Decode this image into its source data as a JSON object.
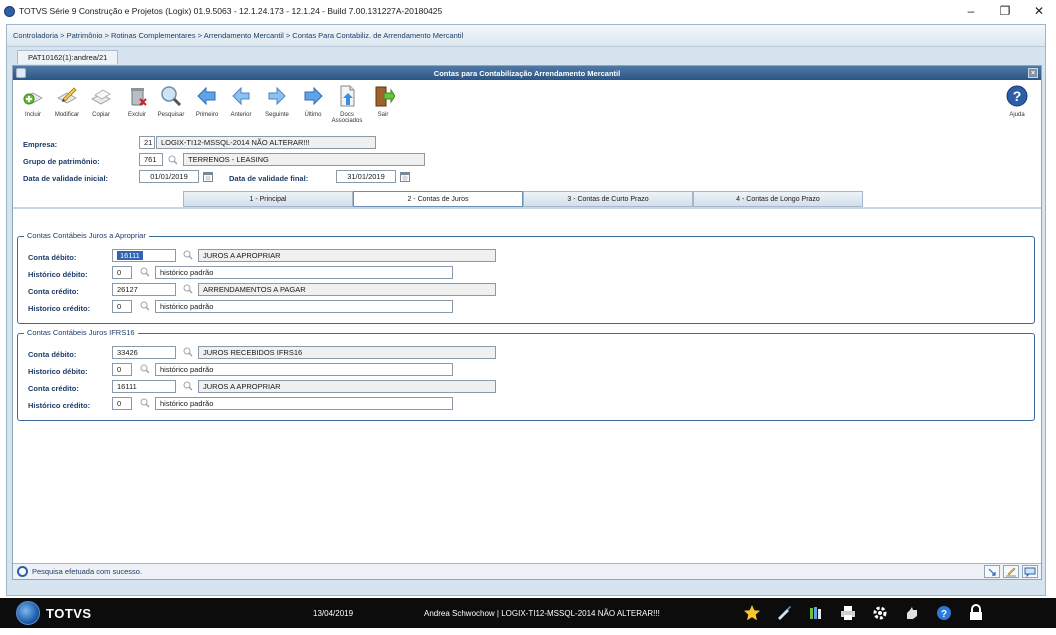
{
  "window": {
    "title": "TOTVS Série 9 Construção e Projetos (Logix) 01.9.5063  -  12.1.24.173  -  12.1.24 - Build 7.00.131227A-20180425",
    "minimize": "–",
    "maximize": "❐",
    "close": "✕"
  },
  "breadcrumb": "Controladoria > Patrimônio > Rotinas Complementares > Arrendamento Mercantil > Contas Para Contabiliz. de Arrendamento Mercantil",
  "program_tab": "PAT10162(1):andrea/21",
  "form_title": "Contas para Contabilização Arrendamento Mercantil",
  "toolbar": {
    "incluir": "Incluir",
    "modificar": "Modificar",
    "copiar": "Copiar",
    "excluir": "Excluir",
    "pesquisar": "Pesquisar",
    "primeiro": "Primeiro",
    "anterior": "Anterior",
    "seguinte": "Seguinte",
    "ultimo": "Último",
    "docs_line1": "Docs",
    "docs_line2": "Associados",
    "sair": "Sair",
    "ajuda": "Ajuda"
  },
  "header": {
    "empresa_label": "Empresa:",
    "empresa_code": "21",
    "empresa_name": "LOGIX-TI12-MSSQL-2014 NÃO ALTERAR!!!",
    "grupo_label": "Grupo de patrimônio:",
    "grupo_code": "761",
    "grupo_name": "TERRENOS - LEASING",
    "data_ini_label": "Data de validade inicial:",
    "data_ini": "01/01/2019",
    "data_fim_label": "Data de validade final:",
    "data_fim": "31/01/2019"
  },
  "tabs": [
    {
      "label": "1 - Principal"
    },
    {
      "label": "2 - Contas de Juros"
    },
    {
      "label": "3 - Contas de Curto Prazo"
    },
    {
      "label": "4 - Contas de Longo Prazo"
    }
  ],
  "group1": {
    "title": "Contas Contábeis Juros a Apropriar",
    "rows": [
      {
        "label": "Conta débito:",
        "code": "16111",
        "desc": "JUROS A APROPRIAR"
      },
      {
        "label": "Histórico débito:",
        "code": "0",
        "desc": "histórico padrão"
      },
      {
        "label": "Conta crédito:",
        "code": "26127",
        "desc": "ARRENDAMENTOS A PAGAR"
      },
      {
        "label": "Historico crédito:",
        "code": "0",
        "desc": "histórico padrão"
      }
    ]
  },
  "group2": {
    "title": "Contas Contábeis Juros IFRS16",
    "rows": [
      {
        "label": "Conta débito:",
        "code": "33426",
        "desc": "JUROS RECEBIDOS IFRS16"
      },
      {
        "label": "Historico débito:",
        "code": "0",
        "desc": "histórico padrão"
      },
      {
        "label": "Conta crédito:",
        "code": "16111",
        "desc": "JUROS A APROPRIAR"
      },
      {
        "label": "Histórico crédito:",
        "code": "0",
        "desc": "histórico padrão"
      }
    ]
  },
  "status_message": "Pesquisa efetuada com sucesso.",
  "taskbar": {
    "brand": "TOTVS",
    "date": "13/04/2019",
    "user_info": "Andrea Schwochow | LOGIX-TI12-MSSQL-2014 NÃO ALTERAR!!!"
  },
  "icons": {
    "incluir": "add-icon",
    "modificar": "edit-icon",
    "copiar": "copy-icon",
    "excluir": "delete-icon",
    "pesquisar": "search-icon",
    "primeiro": "first-arrow-icon",
    "anterior": "prev-arrow-icon",
    "seguinte": "next-arrow-icon",
    "ultimo": "last-arrow-icon",
    "docs": "document-icon",
    "sair": "exit-door-icon",
    "ajuda": "help-icon"
  },
  "colors": {
    "title_bar": "#2b5584",
    "label_text": "#1d3d68",
    "group_border": "#3d6a9a",
    "arrow_blue": "#5fa2e6",
    "selection": "#2f63b6"
  }
}
